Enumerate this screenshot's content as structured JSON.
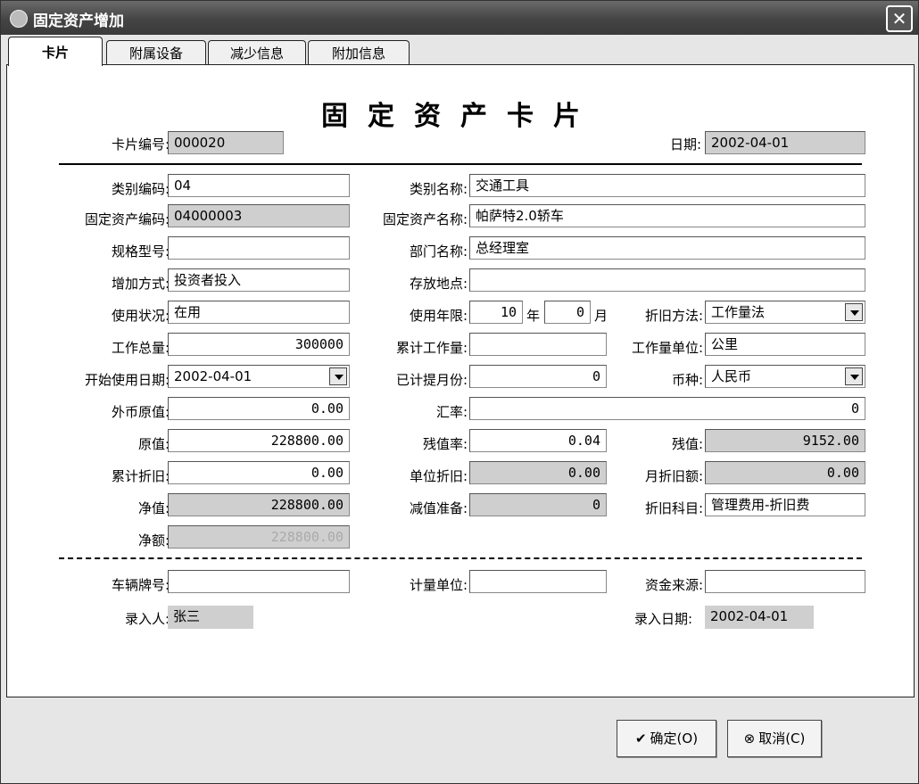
{
  "window": {
    "title": "固定资产增加",
    "close": "✕"
  },
  "tabs": [
    "卡片",
    "附属设备",
    "减少信息",
    "附加信息"
  ],
  "card_title": "固定资产卡片",
  "header": {
    "card_no_label": "卡片编号:",
    "card_no": "000020",
    "date_label": "日期:",
    "date": "2002-04-01"
  },
  "fields": {
    "category_code_label": "类别编码:",
    "category_code": "04",
    "category_name_label": "类别名称:",
    "category_name": "交通工具",
    "asset_code_label": "固定资产编码:",
    "asset_code": "04000003",
    "asset_name_label": "固定资产名称:",
    "asset_name": "帕萨特2.0轿车",
    "spec_label": "规格型号:",
    "spec": "",
    "dept_label": "部门名称:",
    "dept": "总经理室",
    "add_method_label": "增加方式:",
    "add_method": "投资者投入",
    "location_label": "存放地点:",
    "location": "",
    "status_label": "使用状况:",
    "status": "在用",
    "years_label": "使用年限:",
    "years": "10",
    "years_unit": "年",
    "months": "0",
    "months_unit": "月",
    "dep_method_label": "折旧方法:",
    "dep_method": "工作量法",
    "total_work_label": "工作总量:",
    "total_work": "300000",
    "accum_work_label": "累计工作量:",
    "accum_work": "",
    "work_unit_label": "工作量单位:",
    "work_unit": "公里",
    "start_date_label": "开始使用日期:",
    "start_date": "2002-04-01",
    "months_dep_label": "已计提月份:",
    "months_dep": "0",
    "currency_label": "币种:",
    "currency": "人民币",
    "fx_original_label": "外币原值:",
    "fx_original": "0.00",
    "rate_label": "汇率:",
    "rate": "0",
    "original_label": "原值:",
    "original": "228800.00",
    "salvage_rate_label": "残值率:",
    "salvage_rate": "0.04",
    "salvage_label": "残值:",
    "salvage": "9152.00",
    "accum_dep_label": "累计折旧:",
    "accum_dep": "0.00",
    "unit_dep_label": "单位折旧:",
    "unit_dep": "0.00",
    "monthly_dep_label": "月折旧额:",
    "monthly_dep": "0.00",
    "net_value_label": "净值:",
    "net_value": "228800.00",
    "impairment_label": "减值准备:",
    "impairment": "0",
    "dep_account_label": "折旧科目:",
    "dep_account": "管理费用-折旧费",
    "net_amount_label": "净额:",
    "net_amount": "228800.00",
    "plate_label": "车辆牌号:",
    "plate": "",
    "measure_unit_label": "计量单位:",
    "measure_unit": "",
    "fund_source_label": "资金来源:",
    "fund_source": ""
  },
  "footer": {
    "entered_by_label": "录入人:",
    "entered_by": "张三",
    "entry_date_label": "录入日期:",
    "entry_date": "2002-04-01"
  },
  "buttons": {
    "ok": "确定(O)",
    "cancel": "取消(C)"
  }
}
